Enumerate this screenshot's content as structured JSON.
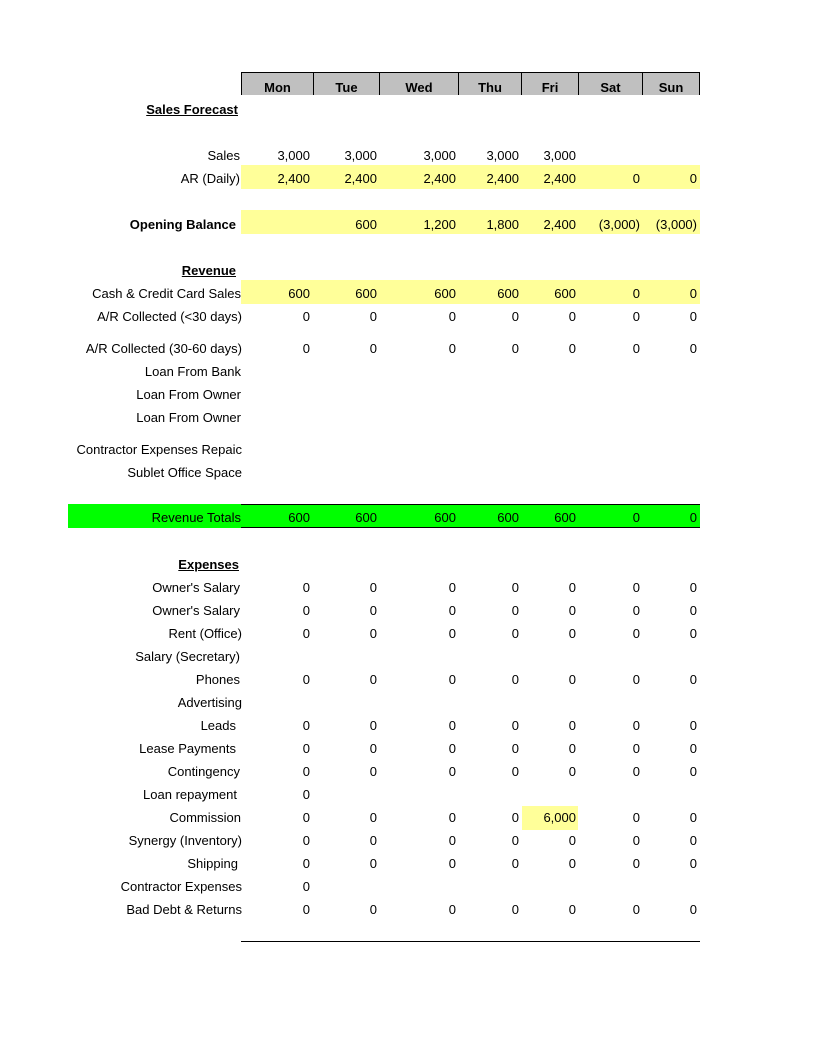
{
  "columns": [
    "Mon",
    "Tue",
    "Wed",
    "Thu",
    "Fri",
    "Sat",
    "Sun"
  ],
  "colors": {
    "header_bg": "#c0c0c0",
    "highlight_yellow": "#ffff99",
    "totals_green": "#00ff00"
  },
  "sections": {
    "sales_forecast": "Sales Forecast",
    "revenue": "Revenue",
    "expenses": "Expenses"
  },
  "rows": {
    "sales": {
      "label": "Sales",
      "values": [
        "3,000",
        "3,000",
        "3,000",
        "3,000",
        "3,000",
        "",
        ""
      ]
    },
    "ar_daily": {
      "label": "AR (Daily)",
      "values": [
        "2,400",
        "2,400",
        "2,400",
        "2,400",
        "2,400",
        "0",
        "0"
      ]
    },
    "opening_balance": {
      "label": "Opening Balance",
      "values": [
        "",
        "600",
        "1,200",
        "1,800",
        "2,400",
        "(3,000)",
        "(3,000)"
      ]
    },
    "cash_cc_sales": {
      "label": "Cash & Credit Card Sales",
      "values": [
        "600",
        "600",
        "600",
        "600",
        "600",
        "0",
        "0"
      ]
    },
    "ar_lt30": {
      "label": "A/R Collected (<30 days)",
      "values": [
        "0",
        "0",
        "0",
        "0",
        "0",
        "0",
        "0"
      ]
    },
    "ar_30_60": {
      "label": "A/R Collected (30-60 days)",
      "values": [
        "0",
        "0",
        "0",
        "0",
        "0",
        "0",
        "0"
      ]
    },
    "loan_bank": {
      "label": "Loan From Bank",
      "values": [
        "",
        "",
        "",
        "",
        "",
        "",
        ""
      ]
    },
    "loan_owner_1": {
      "label": "Loan From Owner",
      "values": [
        "",
        "",
        "",
        "",
        "",
        "",
        ""
      ]
    },
    "loan_owner_2": {
      "label": "Loan From Owner",
      "values": [
        "",
        "",
        "",
        "",
        "",
        "",
        ""
      ]
    },
    "contractor_repaid": {
      "label": "Contractor Expenses Repaic",
      "values": [
        "",
        "",
        "",
        "",
        "",
        "",
        ""
      ]
    },
    "sublet": {
      "label": "Sublet Office Space",
      "values": [
        "",
        "",
        "",
        "",
        "",
        "",
        ""
      ]
    },
    "revenue_totals": {
      "label": "Revenue Totals",
      "values": [
        "600",
        "600",
        "600",
        "600",
        "600",
        "0",
        "0"
      ]
    },
    "owners_salary_1": {
      "label": "Owner's Salary",
      "values": [
        "0",
        "0",
        "0",
        "0",
        "0",
        "0",
        "0"
      ]
    },
    "owners_salary_2": {
      "label": "Owner's Salary",
      "values": [
        "0",
        "0",
        "0",
        "0",
        "0",
        "0",
        "0"
      ]
    },
    "rent": {
      "label": "Rent (Office)",
      "values": [
        "0",
        "0",
        "0",
        "0",
        "0",
        "0",
        "0"
      ]
    },
    "salary_secretary": {
      "label": "Salary (Secretary)",
      "values": [
        "",
        "",
        "",
        "",
        "",
        "",
        ""
      ]
    },
    "phones": {
      "label": "Phones",
      "values": [
        "0",
        "0",
        "0",
        "0",
        "0",
        "0",
        "0"
      ]
    },
    "advertising": {
      "label": "Advertising",
      "values": [
        "",
        "",
        "",
        "",
        "",
        "",
        ""
      ]
    },
    "leads": {
      "label": "Leads",
      "values": [
        "0",
        "0",
        "0",
        "0",
        "0",
        "0",
        "0"
      ]
    },
    "lease_payments": {
      "label": "Lease Payments",
      "values": [
        "0",
        "0",
        "0",
        "0",
        "0",
        "0",
        "0"
      ]
    },
    "contingency": {
      "label": "Contingency",
      "values": [
        "0",
        "0",
        "0",
        "0",
        "0",
        "0",
        "0"
      ]
    },
    "loan_repayment": {
      "label": "Loan repayment",
      "values": [
        "0",
        "",
        "",
        "",
        "",
        "",
        ""
      ]
    },
    "commission": {
      "label": "Commission",
      "values": [
        "0",
        "0",
        "0",
        "0",
        "6,000",
        "0",
        "0"
      ]
    },
    "synergy": {
      "label": "Synergy (Inventory)",
      "values": [
        "0",
        "0",
        "0",
        "0",
        "0",
        "0",
        "0"
      ]
    },
    "shipping": {
      "label": "Shipping",
      "values": [
        "0",
        "0",
        "0",
        "0",
        "0",
        "0",
        "0"
      ]
    },
    "contractor_expenses": {
      "label": "Contractor Expenses",
      "values": [
        "0",
        "",
        "",
        "",
        "",
        "",
        ""
      ]
    },
    "bad_debt": {
      "label": "Bad Debt & Returns",
      "values": [
        "0",
        "0",
        "0",
        "0",
        "0",
        "0",
        "0"
      ]
    }
  }
}
